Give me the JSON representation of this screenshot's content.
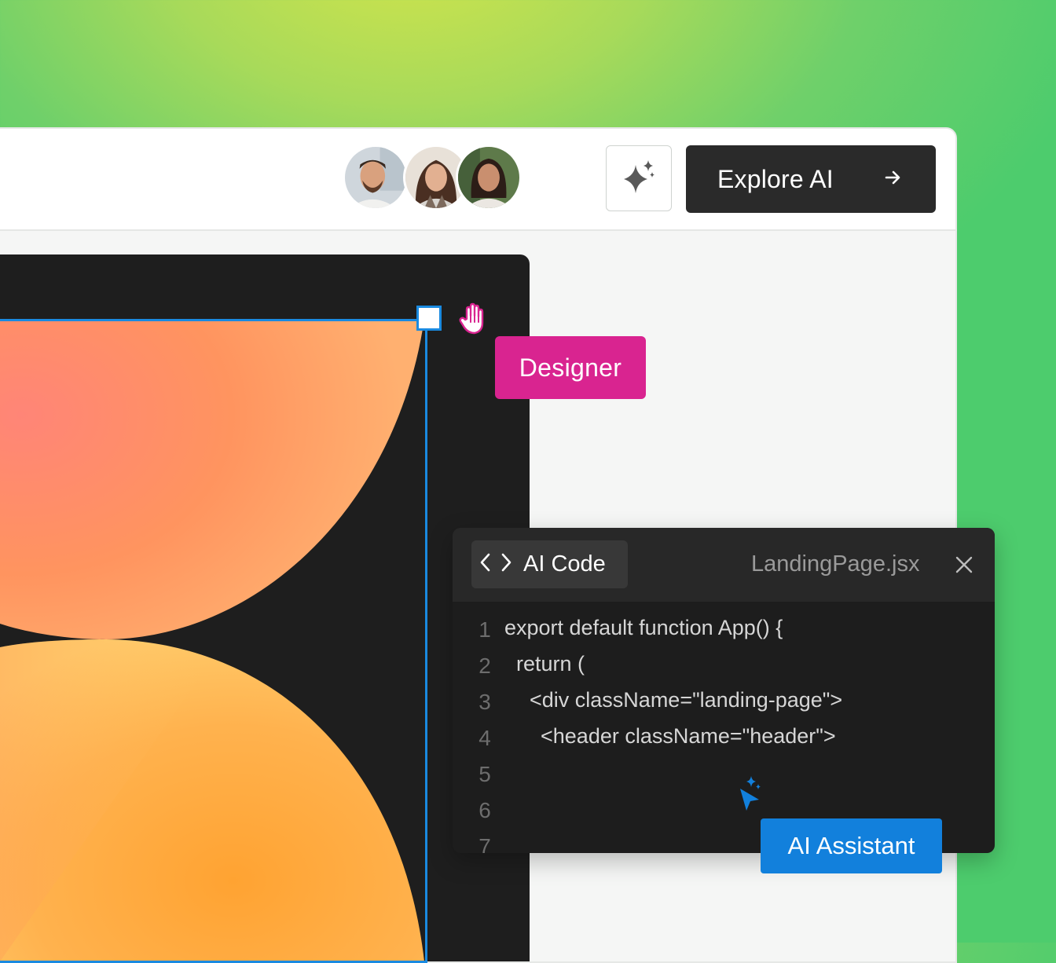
{
  "header": {
    "collaborators": [
      {
        "name": "collaborator-avatar-1"
      },
      {
        "name": "collaborator-avatar-2"
      },
      {
        "name": "collaborator-avatar-3"
      }
    ],
    "ai_icon": "sparkle-icon",
    "explore_label": "Explore AI",
    "explore_icon": "arrow-right-icon"
  },
  "canvas": {
    "designer_label": "Designer",
    "cursor_icon": "hand-cursor-icon",
    "gradient_colors": [
      "#ff8577",
      "#ffa154",
      "#ffc863"
    ],
    "selection_color": "#1a8ae0"
  },
  "code_panel": {
    "tab_icon": "code-brackets-icon",
    "tab_label": "AI Code",
    "filename": "LandingPage.jsx",
    "close_icon": "close-icon",
    "lines": [
      {
        "num": "1",
        "code": "export default function App() {"
      },
      {
        "num": "2",
        "code": "return ("
      },
      {
        "num": "3",
        "code": "<div className=\"landing-page\">"
      },
      {
        "num": "4",
        "code": "<header className=\"header\">"
      },
      {
        "num": "5",
        "code": ""
      },
      {
        "num": "6",
        "code": ""
      },
      {
        "num": "7",
        "code": ""
      }
    ]
  },
  "assistant": {
    "label": "AI Assistant",
    "cursor_icon": "ai-sparkle-cursor-icon"
  },
  "colors": {
    "designer_tag": "#d92490",
    "assistant_tag": "#1280dc",
    "explore_button": "#2a2a2a"
  }
}
